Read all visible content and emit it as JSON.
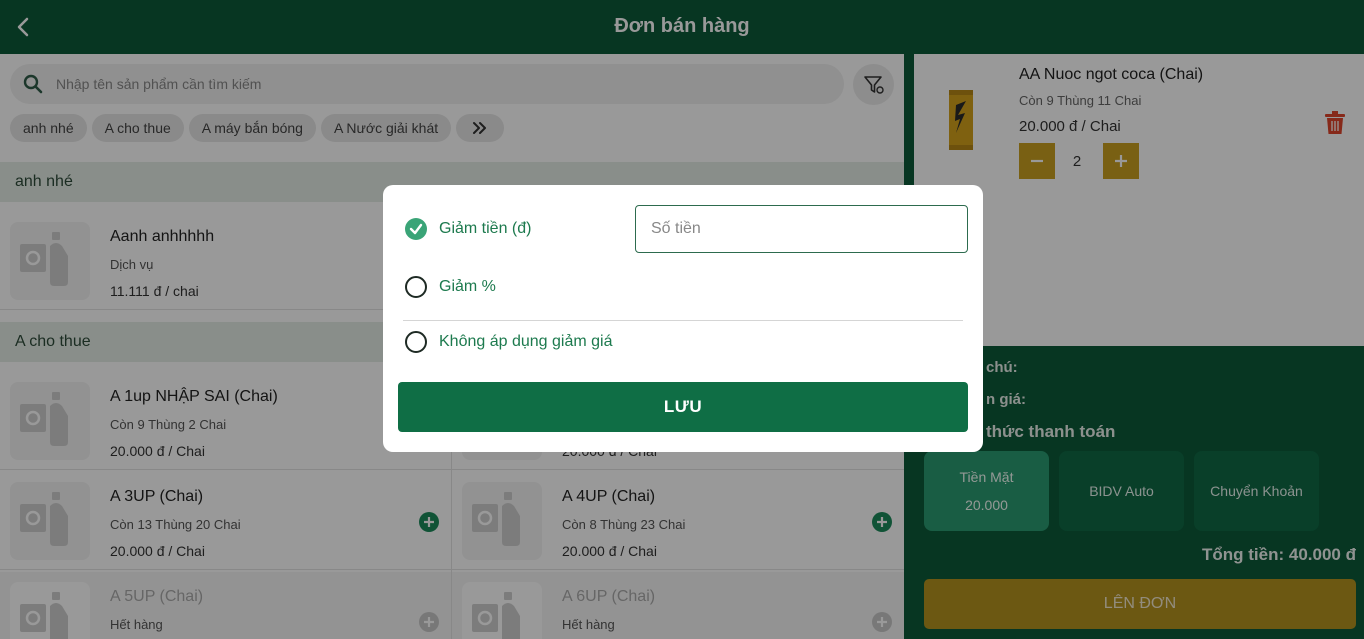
{
  "header": {
    "title": "Đơn bán hàng"
  },
  "search": {
    "placeholder": "Nhập tên sản phẩm cần tìm kiếm"
  },
  "categories": [
    "anh nhé",
    "A cho thue",
    "A máy bắn bóng",
    "A Nước giải khát"
  ],
  "sections": [
    {
      "title": "anh nhé",
      "products": [
        {
          "name": "Aanh anhhhhh",
          "sub": "Dịch vụ",
          "price": "11.111 đ / chai"
        }
      ]
    },
    {
      "title": "A cho thue",
      "products": [
        {
          "name": "A 1up NHẬP SAI (Chai)",
          "sub": "Còn 9 Thùng 2 Chai",
          "price": "20.000 đ / Chai"
        },
        {
          "name": "",
          "sub": "",
          "price": "20.000 đ / Chai"
        },
        {
          "name": "A 3UP (Chai)",
          "sub": "Còn 13 Thùng 20 Chai",
          "price": "20.000 đ / Chai"
        },
        {
          "name": "A 4UP (Chai)",
          "sub": "Còn 8 Thùng 23 Chai",
          "price": "20.000 đ / Chai"
        },
        {
          "name": "A 5UP (Chai)",
          "sub": "Hết hàng",
          "price": ""
        },
        {
          "name": "A 6UP (Chai)",
          "sub": "Hết hàng",
          "price": ""
        }
      ]
    }
  ],
  "cart": {
    "item": {
      "name": "AA Nuoc ngot coca (Chai)",
      "stock": "Còn 9 Thùng 11 Chai",
      "price": "20.000 đ / Chai",
      "qty": "2"
    },
    "note_label": "chú:",
    "discount_label": "n giá:",
    "payment_label": "thức thanh toán",
    "payments": [
      {
        "name": "Tiền Mặt",
        "amount": "20.000",
        "selected": true
      },
      {
        "name": "BIDV Auto",
        "amount": "",
        "selected": false
      },
      {
        "name": "Chuyển Khoản",
        "amount": "",
        "selected": false
      }
    ],
    "total": "Tổng tiền: 40.000 đ",
    "submit_label": "LÊN ĐƠN"
  },
  "modal": {
    "options": [
      {
        "label": "Giảm tiền (đ)",
        "selected": true
      },
      {
        "label": "Giảm %",
        "selected": false
      },
      {
        "label": "Không áp dụng giảm giá",
        "selected": false
      }
    ],
    "amount_placeholder": "Số tiền",
    "save_label": "LƯU"
  },
  "colors": {
    "primary": "#0d5a3a",
    "accent": "#caa121",
    "delete": "#e0452c"
  }
}
